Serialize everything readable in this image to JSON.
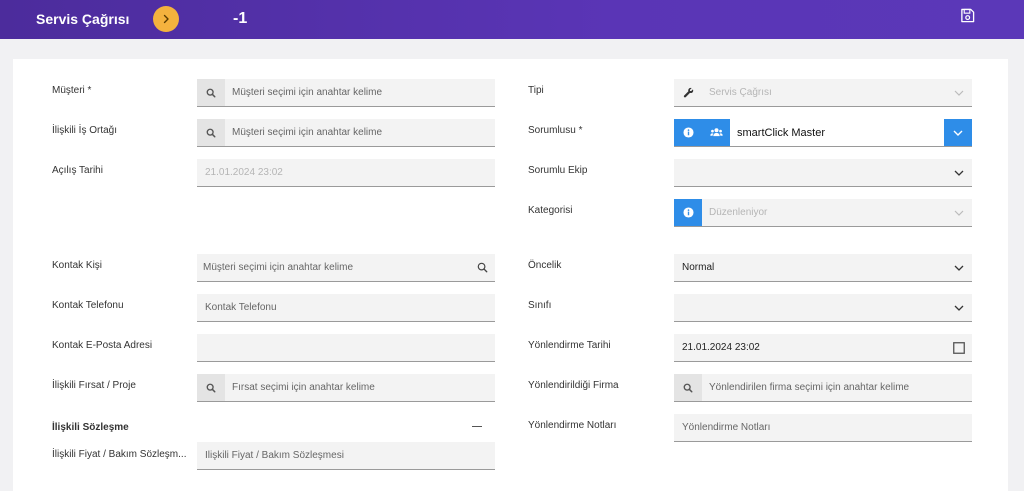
{
  "header": {
    "title": "Servis Çağrısı",
    "record_id": "-1"
  },
  "colors": {
    "header": "#5231a8",
    "accent": "#f4b23e",
    "blue": "#2e8de8"
  },
  "left": {
    "musteri": {
      "label": "Müşteri *",
      "placeholder": "Müşteri seçimi için anahtar kelime"
    },
    "iliskili_is_ortagi": {
      "label": "İlişkili İş Ortağı",
      "placeholder": "Müşteri seçimi için anahtar kelime"
    },
    "acilis_tarihi": {
      "label": "Açılış Tarihi",
      "value": "21.01.2024 23:02"
    },
    "kontak_kisi": {
      "label": "Kontak Kişi",
      "placeholder": "Müşteri seçimi için anahtar kelime"
    },
    "kontak_telefonu": {
      "label": "Kontak Telefonu",
      "placeholder": "Kontak Telefonu"
    },
    "kontak_eposta": {
      "label": "Kontak E-Posta Adresi",
      "value": ""
    },
    "iliskili_firsat": {
      "label": "İlişkili Fırsat / Proje",
      "placeholder": "Fırsat seçimi için anahtar kelime"
    },
    "iliskili_sozlesme": {
      "label": "İlişkili Sözleşme"
    },
    "iliskili_fiyat": {
      "label": "İlişkili Fiyat / Bakım Sözleşm...",
      "placeholder": "İlişkili Fiyat / Bakım Sözleşmesi"
    }
  },
  "right": {
    "tipi": {
      "label": "Tipi",
      "value": "Servis Çağrısı"
    },
    "sorumlusu": {
      "label": "Sorumlusu *",
      "value": "smartClick Master"
    },
    "sorumlu_ekip": {
      "label": "Sorumlu Ekip",
      "value": ""
    },
    "kategorisi": {
      "label": "Kategorisi",
      "value": "Düzenleniyor"
    },
    "oncelik": {
      "label": "Öncelik",
      "value": "Normal"
    },
    "sinifi": {
      "label": "Sınıfı",
      "value": ""
    },
    "yonlendirme_tarihi": {
      "label": "Yönlendirme Tarihi",
      "value": "21.01.2024 23:02"
    },
    "yonlendirildigi_firma": {
      "label": "Yönlendirildiği Firma",
      "placeholder": "Yönlendirilen firma seçimi için anahtar kelime"
    },
    "yonlendirme_notlari": {
      "label": "Yönlendirme Notları",
      "placeholder": "Yönlendirme Notları"
    }
  }
}
